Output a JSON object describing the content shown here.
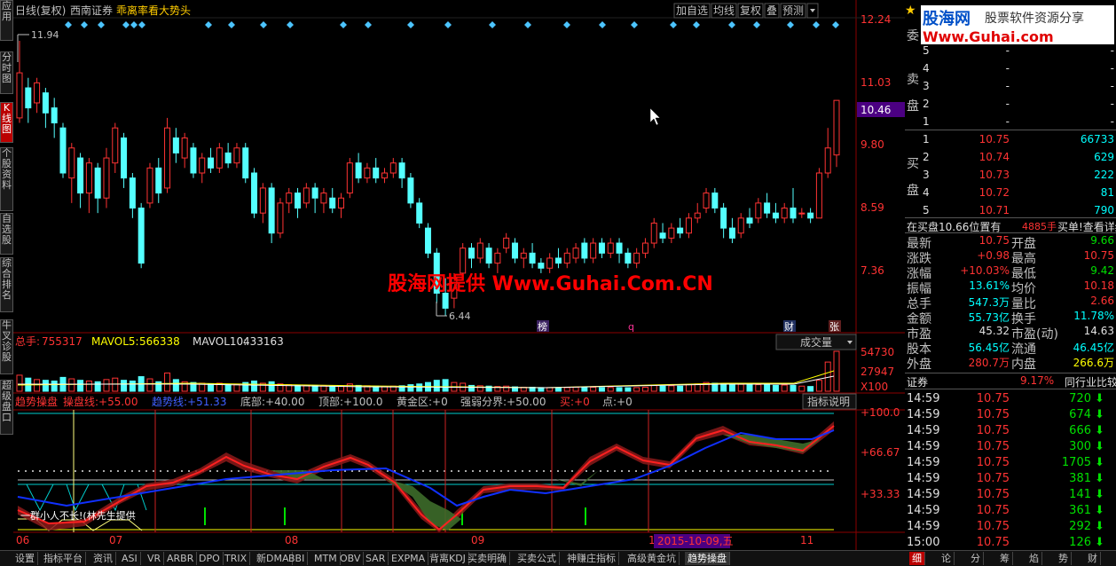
{
  "header": {
    "title": "日线(复权)",
    "stock": "西南证券",
    "formula": "乖离率看大势头",
    "buttons": [
      "加自选",
      "均线",
      "复权",
      "叠",
      "预测"
    ]
  },
  "left_tabs": [
    "应用",
    "分时图",
    "K线图",
    "个股资料",
    "自选股",
    "综合排名",
    "牛叉诊股",
    "超级盘口"
  ],
  "watermark": "股海网提供 Www.Guhai.Com.CN",
  "price_axis": [
    "12.24",
    "11.03",
    "10.46",
    "9.80",
    "8.59",
    "7.36"
  ],
  "high_mark": "11.94",
  "low_mark": "6.44",
  "event_marks": [
    "榜",
    "q",
    "财",
    "张"
  ],
  "volume": {
    "total_label": "总手:",
    "total": "755317",
    "ma5_label": "MAVOL5:",
    "ma5": "566338",
    "ma10_label": "MAVOL10:",
    "ma10": "433163",
    "axis": [
      "54730",
      "27947",
      "X100"
    ],
    "dropdown": "成交量"
  },
  "indicator": {
    "name": "趋势操盘",
    "parts": [
      {
        "label": "操盘线:",
        "value": "+55.00",
        "color": "#ff3333"
      },
      {
        "label": "趋势线:",
        "value": "+51.33",
        "color": "#4060ff"
      },
      {
        "label": "底部:",
        "value": "+40.00",
        "color": "#c0c0c0"
      },
      {
        "label": "顶部:",
        "value": "+100.0",
        "color": "#c0c0c0"
      },
      {
        "label": "黄金区:",
        "value": "+0",
        "color": "#c0c0c0"
      },
      {
        "label": "强弱分界:",
        "value": "+50.00",
        "color": "#c0c0c0"
      },
      {
        "label": "买:",
        "value": "+0",
        "color": "#ff3333"
      },
      {
        "label": "点:",
        "value": "+0",
        "color": "#c0c0c0"
      }
    ],
    "help": "指标说明",
    "axis": [
      "+100.0",
      "+66.67",
      "+33.33"
    ],
    "overlay": "一群小人不长!(林先生提供"
  },
  "date_axis": [
    "06",
    "07",
    "08",
    "09",
    "10",
    "11"
  ],
  "date_cursor": "2015-10-09,五",
  "right": {
    "logo_cn": "股海网",
    "logo_slogan": "股票软件资源分享",
    "logo_url": "Www.Guhai.com",
    "wei": "委",
    "sell_label": "卖盘",
    "buy_label": "买盘",
    "sell": [
      {
        "lvl": "5",
        "price": "-",
        "vol": "-"
      },
      {
        "lvl": "4",
        "price": "-",
        "vol": "-"
      },
      {
        "lvl": "3",
        "price": "-",
        "vol": "-"
      },
      {
        "lvl": "2",
        "price": "-",
        "vol": "-"
      },
      {
        "lvl": "1",
        "price": "-",
        "vol": "-"
      }
    ],
    "buy": [
      {
        "lvl": "1",
        "price": "10.75",
        "vol": "66733"
      },
      {
        "lvl": "2",
        "price": "10.74",
        "vol": "629"
      },
      {
        "lvl": "3",
        "price": "10.73",
        "vol": "222"
      },
      {
        "lvl": "4",
        "price": "10.72",
        "vol": "81"
      },
      {
        "lvl": "5",
        "price": "10.71",
        "vol": "790"
      }
    ],
    "queue_label": "在买盘10.66位置有",
    "queue_vol": "4885手",
    "queue_link": "买单!查看详细",
    "stats": [
      {
        "l1": "最新",
        "v1": "10.75",
        "c1": "#ff3333",
        "l2": "开盘",
        "v2": "9.66",
        "c2": "#00e000"
      },
      {
        "l1": "涨跌",
        "v1": "+0.98",
        "c1": "#ff3333",
        "l2": "最高",
        "v2": "10.75",
        "c2": "#ff3333"
      },
      {
        "l1": "涨幅",
        "v1": "+10.03%",
        "c1": "#ff3333",
        "l2": "最低",
        "v2": "9.42",
        "c2": "#00e000"
      },
      {
        "l1": "振幅",
        "v1": "13.61%",
        "c1": "#00ffff",
        "l2": "均价",
        "v2": "10.18",
        "c2": "#ff3333"
      },
      {
        "l1": "总手",
        "v1": "547.3万",
        "c1": "#00ffff",
        "l2": "量比",
        "v2": "2.66",
        "c2": "#ff3333"
      },
      {
        "l1": "金额",
        "v1": "55.73亿",
        "c1": "#00ffff",
        "l2": "换手",
        "v2": "11.78%",
        "c2": "#00ffff"
      },
      {
        "l1": "市盈",
        "v1": "45.32",
        "c1": "#e0e0e0",
        "l2": "市盈(动)",
        "v2": "14.63",
        "c2": "#e0e0e0"
      },
      {
        "l1": "股本",
        "v1": "56.45亿",
        "c1": "#00ffff",
        "l2": "流通",
        "v2": "46.45亿",
        "c2": "#00ffff"
      },
      {
        "l1": "外盘",
        "v1": "280.7万",
        "c1": "#ff3333",
        "l2": "内盘",
        "v2": "266.6万",
        "c2": "#ffff00"
      }
    ],
    "industry_label": "证券",
    "industry_pct": "9.17%",
    "industry_cmp": "同行业比较",
    "ticks": [
      {
        "t": "14:59",
        "p": "10.75",
        "v": "720"
      },
      {
        "t": "14:59",
        "p": "10.75",
        "v": "674"
      },
      {
        "t": "14:59",
        "p": "10.75",
        "v": "666"
      },
      {
        "t": "14:59",
        "p": "10.75",
        "v": "300"
      },
      {
        "t": "14:59",
        "p": "10.75",
        "v": "1705"
      },
      {
        "t": "14:59",
        "p": "10.75",
        "v": "381"
      },
      {
        "t": "14:59",
        "p": "10.75",
        "v": "141"
      },
      {
        "t": "14:59",
        "p": "10.75",
        "v": "361"
      },
      {
        "t": "14:59",
        "p": "10.75",
        "v": "292"
      },
      {
        "t": "15:00",
        "p": "10.75",
        "v": "126"
      }
    ]
  },
  "bottom_tabs": [
    "设置",
    "指标平台",
    "资讯",
    "ASI",
    "VR",
    "ARBR",
    "DPO",
    "TRIX",
    "新DMA",
    "BBI",
    "MTM",
    "OBV",
    "SAR",
    "EXPMA",
    "背离KDJ",
    "买卖明确",
    "买卖公式",
    "神赚庄指标",
    "高级黄金坑",
    "趋势操盘"
  ],
  "bottom_tabs_right": [
    "细",
    "论",
    "分",
    "筹",
    "焰",
    "势",
    "财"
  ],
  "chart_data": {
    "type": "candlestick",
    "ylim": [
      6.2,
      12.4
    ],
    "high": 11.94,
    "low": 6.44,
    "candles": [
      {
        "o": 10.4,
        "c": 11.3,
        "h": 11.94,
        "l": 10.3
      },
      {
        "o": 11.0,
        "c": 10.6,
        "h": 11.2,
        "l": 10.3
      },
      {
        "o": 10.7,
        "c": 11.1,
        "h": 11.2,
        "l": 10.5
      },
      {
        "o": 10.9,
        "c": 10.5,
        "h": 11.0,
        "l": 10.2
      },
      {
        "o": 10.6,
        "c": 10.3,
        "h": 10.8,
        "l": 10.0
      },
      {
        "o": 10.2,
        "c": 9.3,
        "h": 10.3,
        "l": 9.2
      },
      {
        "o": 9.2,
        "c": 9.8,
        "h": 9.9,
        "l": 8.7
      },
      {
        "o": 9.6,
        "c": 8.9,
        "h": 9.7,
        "l": 8.6
      },
      {
        "o": 8.9,
        "c": 9.5,
        "h": 9.6,
        "l": 8.5
      },
      {
        "o": 9.4,
        "c": 8.8,
        "h": 9.5,
        "l": 8.5
      },
      {
        "o": 8.8,
        "c": 9.6,
        "h": 9.8,
        "l": 8.6
      },
      {
        "o": 9.5,
        "c": 10.2,
        "h": 10.3,
        "l": 9.3
      },
      {
        "o": 10.0,
        "c": 9.2,
        "h": 10.1,
        "l": 9.0
      },
      {
        "o": 9.2,
        "c": 8.6,
        "h": 9.3,
        "l": 8.4
      },
      {
        "o": 8.6,
        "c": 7.5,
        "h": 8.7,
        "l": 7.4
      },
      {
        "o": 8.7,
        "c": 9.4,
        "h": 9.5,
        "l": 8.6
      },
      {
        "o": 9.4,
        "c": 8.9,
        "h": 9.6,
        "l": 8.7
      },
      {
        "o": 9.0,
        "c": 10.2,
        "h": 10.4,
        "l": 8.9
      },
      {
        "o": 10.0,
        "c": 9.7,
        "h": 10.2,
        "l": 9.5
      },
      {
        "o": 9.6,
        "c": 10.0,
        "h": 10.1,
        "l": 9.4
      },
      {
        "o": 9.8,
        "c": 9.3,
        "h": 9.9,
        "l": 9.2
      },
      {
        "o": 9.3,
        "c": 9.6,
        "h": 9.7,
        "l": 9.1
      },
      {
        "o": 9.6,
        "c": 9.4,
        "h": 9.8,
        "l": 9.3
      },
      {
        "o": 9.4,
        "c": 9.8,
        "h": 9.9,
        "l": 9.3
      },
      {
        "o": 9.7,
        "c": 9.5,
        "h": 9.9,
        "l": 9.4
      },
      {
        "o": 9.5,
        "c": 9.8,
        "h": 9.9,
        "l": 9.4
      },
      {
        "o": 9.8,
        "c": 9.2,
        "h": 9.9,
        "l": 9.1
      },
      {
        "o": 9.3,
        "c": 8.5,
        "h": 9.4,
        "l": 8.4
      },
      {
        "o": 8.5,
        "c": 9.0,
        "h": 9.1,
        "l": 8.3
      },
      {
        "o": 9.0,
        "c": 8.1,
        "h": 9.1,
        "l": 7.9
      },
      {
        "o": 8.1,
        "c": 8.7,
        "h": 8.8,
        "l": 8.0
      },
      {
        "o": 8.7,
        "c": 8.9,
        "h": 9.0,
        "l": 8.5
      },
      {
        "o": 8.9,
        "c": 8.6,
        "h": 9.0,
        "l": 8.4
      },
      {
        "o": 8.7,
        "c": 9.0,
        "h": 9.1,
        "l": 8.6
      },
      {
        "o": 9.0,
        "c": 8.8,
        "h": 9.1,
        "l": 8.5
      },
      {
        "o": 8.7,
        "c": 8.9,
        "h": 9.0,
        "l": 8.5
      },
      {
        "o": 8.8,
        "c": 8.6,
        "h": 9.0,
        "l": 8.5
      },
      {
        "o": 8.6,
        "c": 8.8,
        "h": 8.9,
        "l": 8.4
      },
      {
        "o": 8.9,
        "c": 9.5,
        "h": 9.6,
        "l": 8.8
      },
      {
        "o": 9.5,
        "c": 9.2,
        "h": 9.7,
        "l": 9.1
      },
      {
        "o": 9.2,
        "c": 9.4,
        "h": 9.5,
        "l": 9.1
      },
      {
        "o": 9.4,
        "c": 9.2,
        "h": 9.6,
        "l": 9.1
      },
      {
        "o": 9.2,
        "c": 9.3,
        "h": 9.4,
        "l": 9.1
      },
      {
        "o": 9.3,
        "c": 9.5,
        "h": 9.6,
        "l": 9.2
      },
      {
        "o": 9.5,
        "c": 9.2,
        "h": 9.6,
        "l": 9.0
      },
      {
        "o": 9.2,
        "c": 8.7,
        "h": 9.3,
        "l": 8.6
      },
      {
        "o": 8.7,
        "c": 8.3,
        "h": 8.8,
        "l": 8.2
      },
      {
        "o": 8.2,
        "c": 7.7,
        "h": 8.3,
        "l": 7.6
      },
      {
        "o": 7.7,
        "c": 6.9,
        "h": 7.8,
        "l": 6.7
      },
      {
        "o": 6.9,
        "c": 6.6,
        "h": 7.2,
        "l": 6.44
      },
      {
        "o": 6.8,
        "c": 7.2,
        "h": 7.3,
        "l": 6.6
      },
      {
        "o": 7.3,
        "c": 7.8,
        "h": 7.9,
        "l": 7.2
      },
      {
        "o": 7.8,
        "c": 7.6,
        "h": 7.9,
        "l": 7.4
      },
      {
        "o": 7.6,
        "c": 7.9,
        "h": 8.0,
        "l": 7.5
      },
      {
        "o": 7.8,
        "c": 7.5,
        "h": 7.9,
        "l": 7.4
      },
      {
        "o": 7.5,
        "c": 7.7,
        "h": 7.8,
        "l": 7.3
      },
      {
        "o": 7.8,
        "c": 8.0,
        "h": 8.1,
        "l": 7.7
      },
      {
        "o": 7.9,
        "c": 7.6,
        "h": 8.0,
        "l": 7.5
      },
      {
        "o": 7.6,
        "c": 7.7,
        "h": 7.8,
        "l": 7.4
      },
      {
        "o": 7.7,
        "c": 7.5,
        "h": 7.9,
        "l": 7.4
      },
      {
        "o": 7.5,
        "c": 7.4,
        "h": 7.6,
        "l": 7.3
      },
      {
        "o": 7.4,
        "c": 7.6,
        "h": 7.7,
        "l": 7.3
      },
      {
        "o": 7.6,
        "c": 7.5,
        "h": 7.8,
        "l": 7.4
      },
      {
        "o": 7.5,
        "c": 7.7,
        "h": 7.8,
        "l": 7.4
      },
      {
        "o": 7.6,
        "c": 7.8,
        "h": 7.9,
        "l": 7.5
      },
      {
        "o": 7.9,
        "c": 7.6,
        "h": 8.0,
        "l": 7.5
      },
      {
        "o": 7.6,
        "c": 7.9,
        "h": 8.0,
        "l": 7.5
      },
      {
        "o": 7.9,
        "c": 7.7,
        "h": 8.0,
        "l": 7.6
      },
      {
        "o": 7.7,
        "c": 7.9,
        "h": 8.0,
        "l": 7.6
      },
      {
        "o": 7.9,
        "c": 7.7,
        "h": 8.0,
        "l": 7.5
      },
      {
        "o": 7.7,
        "c": 7.5,
        "h": 7.8,
        "l": 7.4
      },
      {
        "o": 7.5,
        "c": 7.7,
        "h": 7.8,
        "l": 7.4
      },
      {
        "o": 7.7,
        "c": 7.9,
        "h": 8.0,
        "l": 7.6
      },
      {
        "o": 7.9,
        "c": 8.3,
        "h": 8.4,
        "l": 7.8
      },
      {
        "o": 8.1,
        "c": 8.0,
        "h": 8.3,
        "l": 7.9
      },
      {
        "o": 8.0,
        "c": 8.2,
        "h": 8.3,
        "l": 7.9
      },
      {
        "o": 8.2,
        "c": 8.1,
        "h": 8.4,
        "l": 8.0
      },
      {
        "o": 8.1,
        "c": 8.4,
        "h": 8.5,
        "l": 8.0
      },
      {
        "o": 8.4,
        "c": 8.5,
        "h": 8.7,
        "l": 8.3
      },
      {
        "o": 8.6,
        "c": 8.9,
        "h": 9.0,
        "l": 8.5
      },
      {
        "o": 8.9,
        "c": 8.6,
        "h": 9.0,
        "l": 8.5
      },
      {
        "o": 8.6,
        "c": 8.2,
        "h": 8.7,
        "l": 8.0
      },
      {
        "o": 8.2,
        "c": 8.0,
        "h": 8.4,
        "l": 7.9
      },
      {
        "o": 8.1,
        "c": 8.4,
        "h": 8.5,
        "l": 8.0
      },
      {
        "o": 8.4,
        "c": 8.3,
        "h": 8.6,
        "l": 8.2
      },
      {
        "o": 8.4,
        "c": 8.7,
        "h": 8.8,
        "l": 8.3
      },
      {
        "o": 8.7,
        "c": 8.5,
        "h": 8.9,
        "l": 8.4
      },
      {
        "o": 8.5,
        "c": 8.4,
        "h": 8.7,
        "l": 8.3
      },
      {
        "o": 8.4,
        "c": 8.6,
        "h": 8.7,
        "l": 8.3
      },
      {
        "o": 8.6,
        "c": 8.4,
        "h": 9.0,
        "l": 8.3
      },
      {
        "o": 8.5,
        "c": 8.5,
        "h": 8.6,
        "l": 8.4
      },
      {
        "o": 8.5,
        "c": 8.4,
        "h": 8.6,
        "l": 8.3
      },
      {
        "o": 8.4,
        "c": 9.3,
        "h": 9.4,
        "l": 8.4
      },
      {
        "o": 9.3,
        "c": 9.8,
        "h": 10.2,
        "l": 9.2
      },
      {
        "o": 9.66,
        "c": 10.75,
        "h": 10.75,
        "l": 9.42
      }
    ],
    "volume": [
      {
        "v": 22000,
        "up": true
      },
      {
        "v": 18000,
        "up": false
      },
      {
        "v": 16000,
        "up": true
      },
      {
        "v": 15000,
        "up": false
      },
      {
        "v": 14000,
        "up": false
      },
      {
        "v": 19000,
        "up": false
      },
      {
        "v": 17000,
        "up": true
      },
      {
        "v": 15000,
        "up": false
      },
      {
        "v": 14000,
        "up": true
      },
      {
        "v": 13000,
        "up": false
      },
      {
        "v": 16000,
        "up": true
      },
      {
        "v": 18000,
        "up": true
      },
      {
        "v": 15000,
        "up": false
      },
      {
        "v": 14000,
        "up": false
      },
      {
        "v": 20000,
        "up": false
      },
      {
        "v": 17000,
        "up": true
      },
      {
        "v": 13000,
        "up": false
      },
      {
        "v": 25000,
        "up": true
      },
      {
        "v": 16000,
        "up": false
      },
      {
        "v": 13000,
        "up": true
      },
      {
        "v": 12000,
        "up": false
      },
      {
        "v": 11000,
        "up": true
      },
      {
        "v": 10000,
        "up": false
      },
      {
        "v": 11000,
        "up": true
      },
      {
        "v": 9000,
        "up": false
      },
      {
        "v": 9500,
        "up": true
      },
      {
        "v": 12000,
        "up": false
      },
      {
        "v": 14000,
        "up": false
      },
      {
        "v": 11000,
        "up": true
      },
      {
        "v": 13000,
        "up": false
      },
      {
        "v": 10000,
        "up": true
      },
      {
        "v": 9000,
        "up": true
      },
      {
        "v": 8000,
        "up": false
      },
      {
        "v": 8500,
        "up": true
      },
      {
        "v": 8000,
        "up": false
      },
      {
        "v": 7500,
        "up": true
      },
      {
        "v": 7000,
        "up": false
      },
      {
        "v": 7000,
        "up": true
      },
      {
        "v": 10000,
        "up": true
      },
      {
        "v": 8000,
        "up": false
      },
      {
        "v": 7500,
        "up": true
      },
      {
        "v": 7000,
        "up": false
      },
      {
        "v": 6500,
        "up": true
      },
      {
        "v": 7000,
        "up": true
      },
      {
        "v": 7500,
        "up": false
      },
      {
        "v": 9000,
        "up": false
      },
      {
        "v": 10000,
        "up": false
      },
      {
        "v": 12000,
        "up": false
      },
      {
        "v": 15000,
        "up": false
      },
      {
        "v": 16000,
        "up": false
      },
      {
        "v": 12000,
        "up": true
      },
      {
        "v": 11000,
        "up": true
      },
      {
        "v": 8000,
        "up": false
      },
      {
        "v": 7500,
        "up": true
      },
      {
        "v": 7000,
        "up": false
      },
      {
        "v": 6500,
        "up": true
      },
      {
        "v": 7000,
        "up": true
      },
      {
        "v": 6000,
        "up": false
      },
      {
        "v": 5500,
        "up": true
      },
      {
        "v": 5500,
        "up": false
      },
      {
        "v": 5000,
        "up": false
      },
      {
        "v": 5000,
        "up": true
      },
      {
        "v": 4800,
        "up": false
      },
      {
        "v": 5000,
        "up": true
      },
      {
        "v": 5500,
        "up": true
      },
      {
        "v": 5200,
        "up": false
      },
      {
        "v": 5500,
        "up": true
      },
      {
        "v": 5000,
        "up": false
      },
      {
        "v": 5200,
        "up": true
      },
      {
        "v": 5000,
        "up": false
      },
      {
        "v": 4800,
        "up": false
      },
      {
        "v": 5000,
        "up": true
      },
      {
        "v": 5500,
        "up": true
      },
      {
        "v": 8000,
        "up": true
      },
      {
        "v": 7000,
        "up": false
      },
      {
        "v": 7500,
        "up": true
      },
      {
        "v": 7000,
        "up": false
      },
      {
        "v": 9000,
        "up": true
      },
      {
        "v": 10000,
        "up": true
      },
      {
        "v": 12000,
        "up": true
      },
      {
        "v": 11000,
        "up": false
      },
      {
        "v": 10000,
        "up": false
      },
      {
        "v": 9000,
        "up": false
      },
      {
        "v": 9500,
        "up": true
      },
      {
        "v": 8500,
        "up": false
      },
      {
        "v": 9000,
        "up": true
      },
      {
        "v": 8500,
        "up": false
      },
      {
        "v": 8000,
        "up": false
      },
      {
        "v": 8500,
        "up": true
      },
      {
        "v": 8000,
        "up": false
      },
      {
        "v": 7000,
        "up": true
      },
      {
        "v": 6500,
        "up": false
      },
      {
        "v": 15000,
        "up": true
      },
      {
        "v": 40000,
        "up": true
      },
      {
        "v": 54730,
        "up": true
      }
    ]
  }
}
